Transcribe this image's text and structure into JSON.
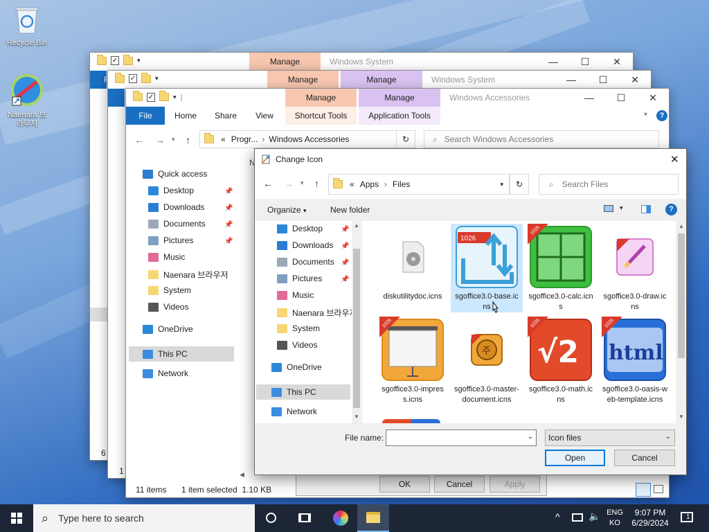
{
  "desktop": {
    "icons": [
      {
        "label": "Recycle Bin"
      },
      {
        "label": "Naenara 브라우저"
      }
    ]
  },
  "win_back1": {
    "title": "Windows System",
    "manage_label": "Manage",
    "file_tab_partial": "F",
    "status_partial": "6 i"
  },
  "win_back2": {
    "title": "Windows System",
    "manage1_label": "Manage",
    "manage2_label": "Manage",
    "file_tab_partial": "F",
    "status_partial": "1 i"
  },
  "explorer": {
    "title": "Windows Accessories",
    "manage1_label": "Manage",
    "manage2_label": "Manage",
    "tabs": [
      "File",
      "Home",
      "Share",
      "View",
      "Shortcut Tools",
      "Application Tools"
    ],
    "address": {
      "prefix": "«",
      "crumb1": "Progr...",
      "crumb2": "Windows Accessories"
    },
    "search_placeholder": "Search Windows Accessories",
    "nav": [
      {
        "label": "Quick access",
        "color": "#2b7cd3"
      },
      {
        "label": "Desktop",
        "color": "#2b88d8",
        "pinned": true
      },
      {
        "label": "Downloads",
        "color": "#2b7cd3",
        "pinned": true
      },
      {
        "label": "Documents",
        "color": "#9aa8b8",
        "pinned": true
      },
      {
        "label": "Pictures",
        "color": "#7fa0c0",
        "pinned": true
      },
      {
        "label": "Music",
        "color": "#e06b9a"
      },
      {
        "label": "Naenara 브라우저",
        "color": "#f7d774"
      },
      {
        "label": "System",
        "color": "#f7d774"
      },
      {
        "label": "Videos",
        "color": "#555555"
      },
      {
        "label": "OneDrive",
        "color": "#2b88d8"
      },
      {
        "label": "This PC",
        "color": "#3a8dde"
      },
      {
        "label": "Network",
        "color": "#3a8dde"
      }
    ],
    "col_partial": "N",
    "status": {
      "items": "11 items",
      "selected": "1 item selected  1.10 KB"
    }
  },
  "props_buttons": {
    "ok": "OK",
    "cancel": "Cancel",
    "apply": "Apply"
  },
  "dialog": {
    "title": "Change Icon",
    "address": {
      "prefix": "«",
      "crumb1": "Apps",
      "crumb2": "Files"
    },
    "search_placeholder": "Search Files",
    "organize": "Organize",
    "new_folder": "New folder",
    "nav": [
      {
        "label": "Desktop",
        "color": "#2b88d8",
        "pinned": true
      },
      {
        "label": "Downloads",
        "color": "#2b7cd3",
        "pinned": true
      },
      {
        "label": "Documents",
        "color": "#9aa8b8",
        "pinned": true
      },
      {
        "label": "Pictures",
        "color": "#7fa0c0",
        "pinned": true
      },
      {
        "label": "Music",
        "color": "#e06b9a"
      },
      {
        "label": "Naenara 브라우저",
        "color": "#f7d774"
      },
      {
        "label": "System",
        "color": "#f7d774"
      },
      {
        "label": "Videos",
        "color": "#555555"
      },
      {
        "label": "OneDrive",
        "color": "#2b88d8"
      },
      {
        "label": "This PC",
        "color": "#3a8dde"
      },
      {
        "label": "Network",
        "color": "#3a8dde"
      }
    ],
    "files": [
      {
        "name": "diskutilitydoc.icns",
        "icon": "disk-doc-icon"
      },
      {
        "name": "sgoffice3.0-base.icns",
        "icon": "base-icon",
        "selected": true
      },
      {
        "name": "sgoffice3.0-calc.icns",
        "icon": "calc-icon"
      },
      {
        "name": "sgoffice3.0-draw.icns",
        "icon": "draw-icon"
      },
      {
        "name": "sgoffice3.0-impress.icns",
        "icon": "impress-icon"
      },
      {
        "name": "sgoffice3.0-master-document.icns",
        "icon": "master-doc-icon"
      },
      {
        "name": "sgoffice3.0-math.icns",
        "icon": "math-icon"
      },
      {
        "name": "sgoffice3.0-oasis-web-template.icns",
        "icon": "html-icon"
      }
    ],
    "badge": "1026",
    "math_glyph": "√2",
    "html_glyph": "html",
    "master_glyph": "주",
    "file_name_label": "File name:",
    "file_name_value": "",
    "filter": "Icon files",
    "open": "Open",
    "cancel": "Cancel"
  },
  "taskbar": {
    "search_placeholder": "Type here to search",
    "lang1": "ENG",
    "lang2": "KO",
    "time": "9:07 PM",
    "date": "6/29/2024",
    "notif_count": "1"
  }
}
